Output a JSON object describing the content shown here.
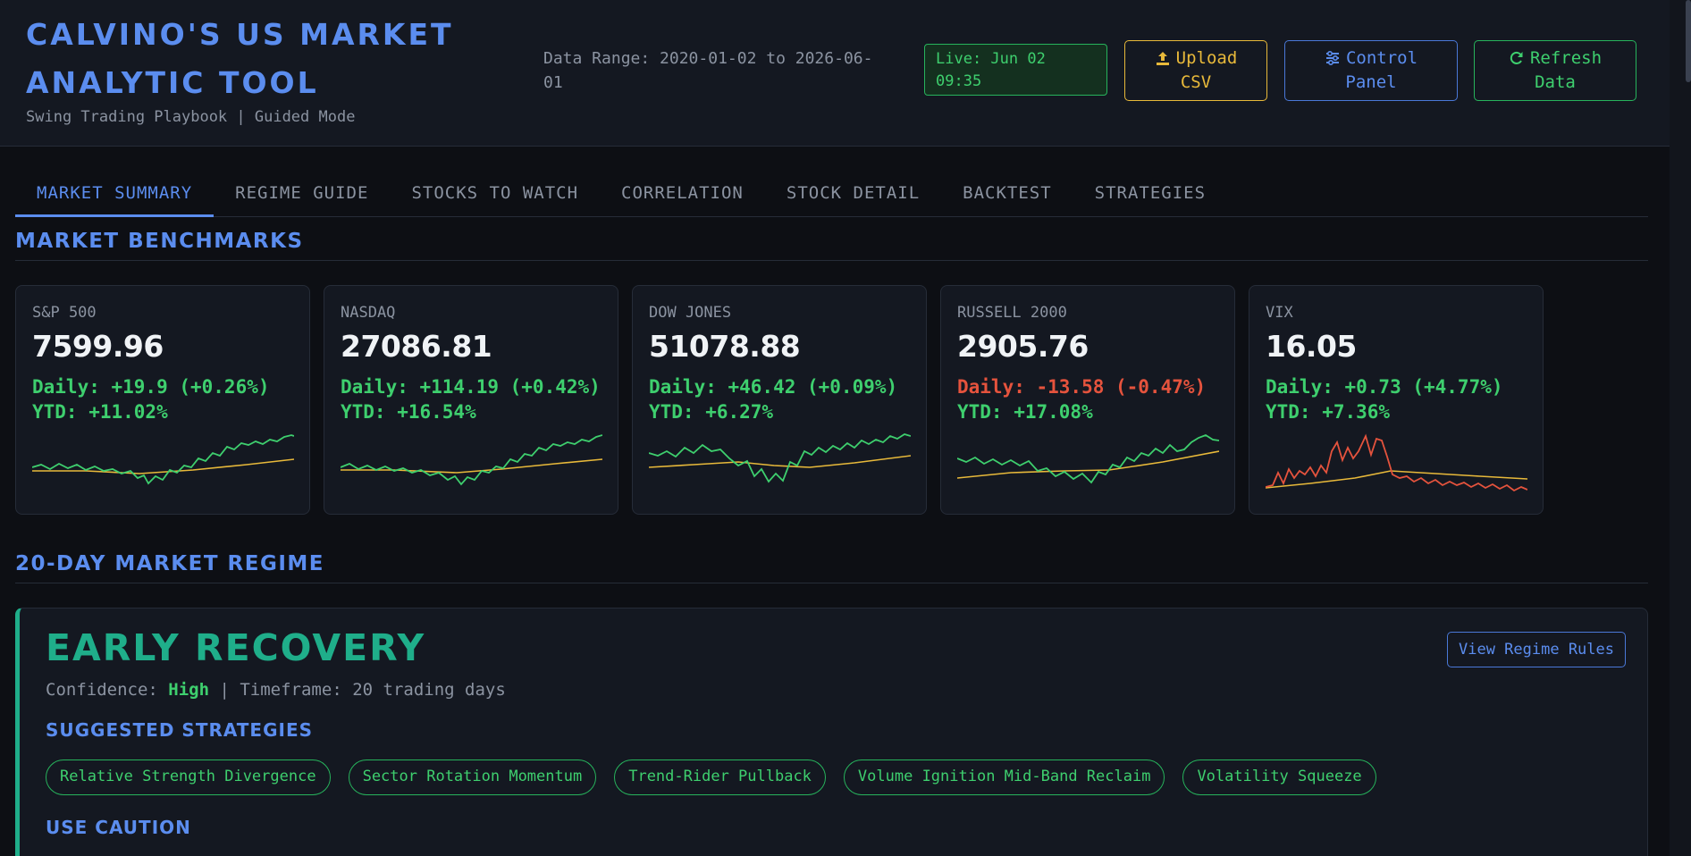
{
  "header": {
    "title": "CALVINO'S US MARKET ANALYTIC TOOL",
    "subtitle": "Swing Trading Playbook | Guided Mode",
    "data_range": "Data Range: 2020-01-02 to 2026-06-01",
    "live": "Live: Jun 02 09:35",
    "buttons": {
      "upload": "Upload CSV",
      "control": "Control Panel",
      "refresh": "Refresh Data"
    }
  },
  "tabs": [
    {
      "label": "MARKET SUMMARY",
      "active": true
    },
    {
      "label": "REGIME GUIDE"
    },
    {
      "label": "STOCKS TO WATCH"
    },
    {
      "label": "CORRELATION"
    },
    {
      "label": "STOCK DETAIL"
    },
    {
      "label": "BACKTEST"
    },
    {
      "label": "STRATEGIES"
    }
  ],
  "benchmarks": {
    "title": "MARKET BENCHMARKS",
    "cards": [
      {
        "name": "S&P 500",
        "value": "7599.96",
        "daily": "Daily: +19.9 (+0.26%)",
        "ytd": "YTD: +11.02%",
        "direction": "up"
      },
      {
        "name": "NASDAQ",
        "value": "27086.81",
        "daily": "Daily: +114.19 (+0.42%)",
        "ytd": "YTD: +16.54%",
        "direction": "up"
      },
      {
        "name": "DOW JONES",
        "value": "51078.88",
        "daily": "Daily: +46.42 (+0.09%)",
        "ytd": "YTD: +6.27%",
        "direction": "up"
      },
      {
        "name": "RUSSELL 2000",
        "value": "2905.76",
        "daily": "Daily: -13.58 (-0.47%)",
        "ytd": "YTD: +17.08%",
        "direction": "down"
      },
      {
        "name": "VIX",
        "value": "16.05",
        "daily": "Daily: +0.73 (+4.77%)",
        "ytd": "YTD: +7.36%",
        "direction": "up"
      }
    ]
  },
  "regime": {
    "section_title": "20-DAY MARKET REGIME",
    "name": "EARLY RECOVERY",
    "confidence_label": "Confidence: ",
    "confidence": "High",
    "timeframe": " | Timeframe: 20 trading days",
    "rules_button": "View Regime Rules",
    "suggested_title": "SUGGESTED STRATEGIES",
    "strategies": [
      "Relative Strength Divergence",
      "Sector Rotation Momentum",
      "Trend-Rider Pullback",
      "Volume Ignition Mid-Band Reclaim",
      "Volatility Squeeze"
    ],
    "caution_title": "USE CAUTION"
  },
  "colors": {
    "accent": "#5b8def",
    "up": "#3ecf6e",
    "down": "#e5533d",
    "ma_line": "#e8b93a",
    "regime": "#1fae8a"
  }
}
